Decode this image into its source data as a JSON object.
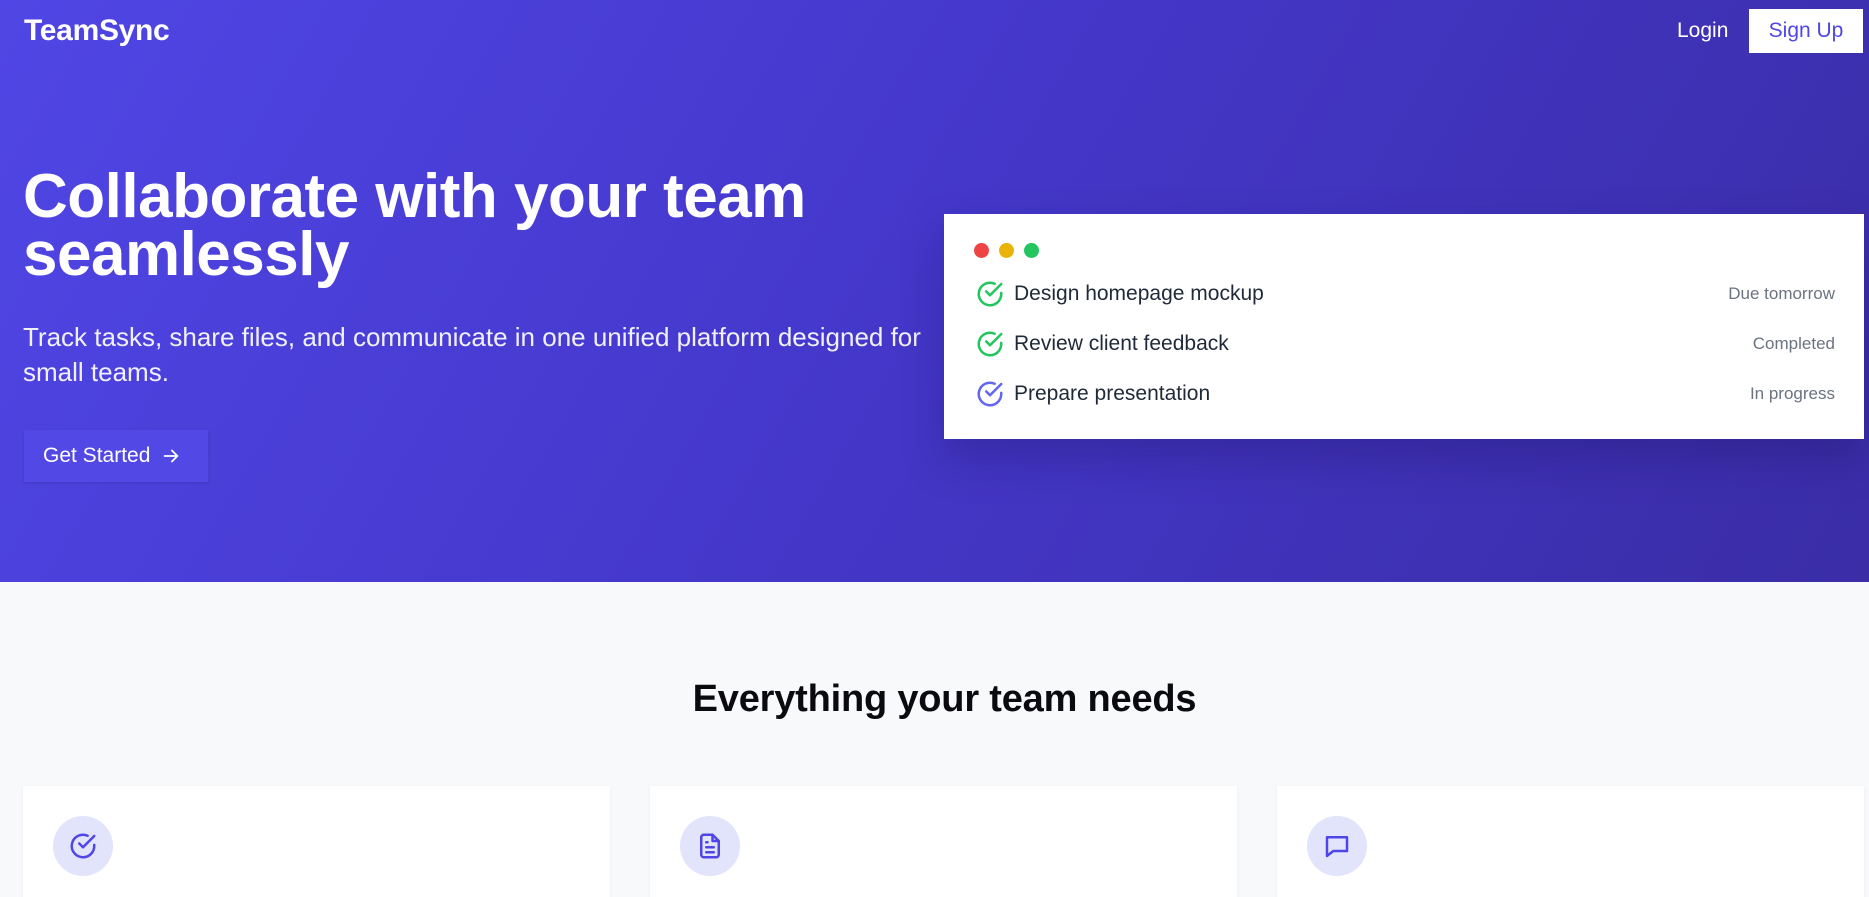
{
  "nav": {
    "brand": "TeamSync",
    "login_label": "Login",
    "signup_label": "Sign Up"
  },
  "hero": {
    "title": "Collaborate with your team seamlessly",
    "subtitle": "Track tasks, share files, and communicate in one unified platform designed for small teams.",
    "cta_label": "Get Started",
    "cta_icon": "arrow-right-icon"
  },
  "preview_window": {
    "dot_colors": [
      "#ef4444",
      "#eab308",
      "#22c55e"
    ],
    "tasks": [
      {
        "label": "Design homepage mockup",
        "status": "Due tomorrow",
        "icon": "check-circle-icon",
        "icon_color": "#22c55e"
      },
      {
        "label": "Review client feedback",
        "status": "Completed",
        "icon": "check-circle-icon",
        "icon_color": "#22c55e"
      },
      {
        "label": "Prepare presentation",
        "status": "In progress",
        "icon": "check-circle-icon",
        "icon_color": "#6366f1"
      }
    ]
  },
  "features": {
    "title": "Everything your team needs",
    "cards": [
      {
        "icon": "check-circle-icon"
      },
      {
        "icon": "document-icon"
      },
      {
        "icon": "chat-bubble-icon"
      }
    ]
  },
  "colors": {
    "accent": "#4f46e5",
    "hero_gradient_start": "#5046e5",
    "hero_gradient_end": "#3a2da6",
    "icon_bg": "#e1e4fb"
  }
}
